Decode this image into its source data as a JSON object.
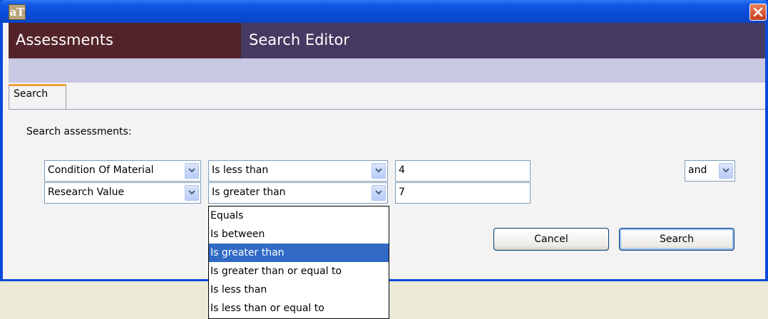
{
  "window": {
    "icon_text": "aT"
  },
  "header": {
    "left_title": "Assessments",
    "right_title": "Search Editor"
  },
  "tabs": [
    {
      "label": "Search"
    }
  ],
  "search": {
    "prompt": "Search assessments:",
    "rows": [
      {
        "field": "Condition Of Material",
        "operator": "Is less than",
        "value": "4"
      },
      {
        "field": "Research Value",
        "operator": "Is greater than",
        "value": "7"
      }
    ],
    "conjunction": "and"
  },
  "buttons": {
    "cancel": "Cancel",
    "search": "Search"
  },
  "operator_dropdown": {
    "options": [
      "Equals",
      "Is between",
      "Is greater than",
      "Is greater than or equal to",
      "Is less than",
      "Is less than or equal to"
    ],
    "selected": "Is greater than"
  },
  "colors": {
    "selection": "#316ac5",
    "header_left": "#53232a",
    "header_right": "#443a62"
  }
}
